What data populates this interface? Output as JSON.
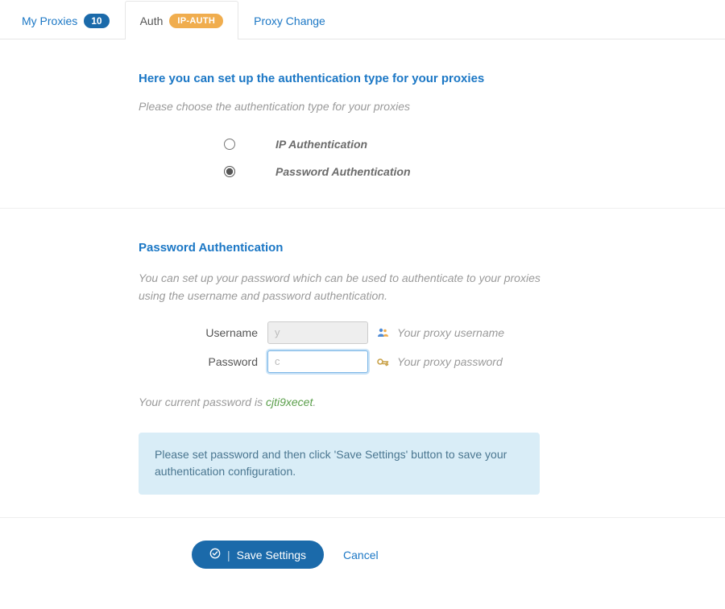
{
  "tabs": {
    "my_proxies": {
      "label": "My Proxies",
      "count": "10"
    },
    "auth": {
      "label": "Auth",
      "badge": "IP-AUTH"
    },
    "proxy_change": {
      "label": "Proxy Change"
    }
  },
  "section1": {
    "heading": "Here you can set up the authentication type for your proxies",
    "sub": "Please choose the authentication type for your proxies",
    "radio_ip": "IP Authentication",
    "radio_password": "Password Authentication"
  },
  "section2": {
    "heading": "Password Authentication",
    "sub": "You can set up your password which can be used to authenticate to your proxies using the username and password authentication.",
    "username_label": "Username",
    "username_value": "y",
    "username_hint": "Your proxy username",
    "password_label": "Password",
    "password_value": "c",
    "password_hint": "Your proxy password",
    "note_prefix": "Your current password is ",
    "note_pw": "cjti9xecet",
    "note_suffix": ".",
    "alert": "Please set password and then click 'Save Settings' button to save your authentication configuration."
  },
  "footer": {
    "save": "Save Settings",
    "cancel": "Cancel"
  }
}
